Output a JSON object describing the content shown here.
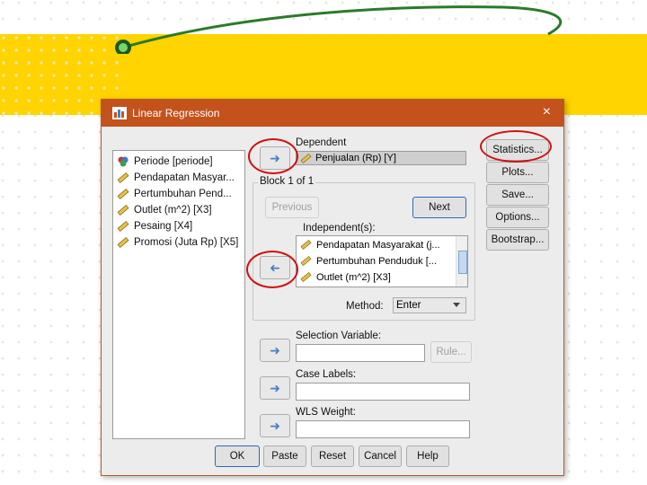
{
  "dialog": {
    "title": "Linear Regression",
    "close_icon": "×"
  },
  "variables": [
    {
      "label": "Periode [periode]",
      "icon": "nominal-icon"
    },
    {
      "label": "Pendapatan Masyar...",
      "icon": "ruler-icon"
    },
    {
      "label": "Pertumbuhan Pend...",
      "icon": "ruler-icon"
    },
    {
      "label": "Outlet (m^2) [X3]",
      "icon": "ruler-icon"
    },
    {
      "label": "Pesaing [X4]",
      "icon": "ruler-icon"
    },
    {
      "label": "Promosi (Juta Rp) [X5]",
      "icon": "ruler-icon"
    }
  ],
  "dependent": {
    "label": "Dependent",
    "value": "Penjualan (Rp) [Y]"
  },
  "block": {
    "label": "Block 1 of 1",
    "previous": "Previous",
    "next": "Next"
  },
  "independents": {
    "label": "Independent(s):",
    "items": [
      "Pendapatan Masyarakat (j...",
      "Pertumbuhan Penduduk [...",
      "Outlet (m^2) [X3]"
    ]
  },
  "method": {
    "label": "Method:",
    "value": "Enter"
  },
  "selection": {
    "label": "Selection Variable:",
    "rule": "Rule..."
  },
  "case_labels": {
    "label": "Case Labels:"
  },
  "wls": {
    "label": "WLS Weight:"
  },
  "side_buttons": {
    "statistics": "Statistics...",
    "plots": "Plots...",
    "save": "Save...",
    "options": "Options...",
    "bootstrap": "Bootstrap..."
  },
  "footer": {
    "ok": "OK",
    "paste": "Paste",
    "reset": "Reset",
    "cancel": "Cancel",
    "help": "Help"
  },
  "colors": {
    "titlebar": "#c4521c",
    "highlight_ring": "#d01010",
    "slide_band": "#ffd400"
  }
}
